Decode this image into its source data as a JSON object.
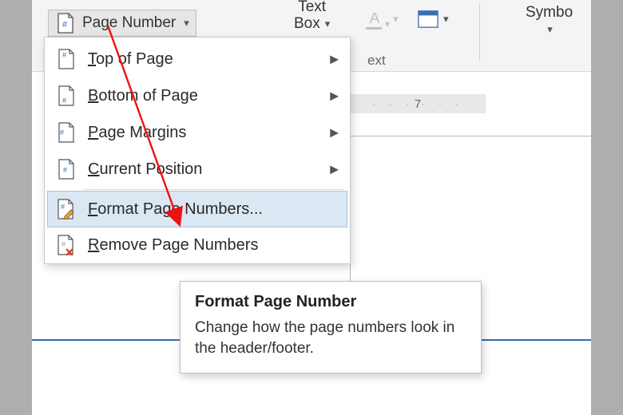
{
  "ribbon": {
    "page_number_label": "Page Number",
    "text_box_line1": "Text",
    "text_box_line2": "Box",
    "font_color_label": "A",
    "symbol_label": "Symbo",
    "group_label_text": "ext"
  },
  "ruler": {
    "tick_label": "7"
  },
  "menu": {
    "items": [
      {
        "label_pre": "",
        "mnemonic": "T",
        "label_post": "op of Page",
        "has_submenu": true
      },
      {
        "label_pre": "",
        "mnemonic": "B",
        "label_post": "ottom of Page",
        "has_submenu": true
      },
      {
        "label_pre": "",
        "mnemonic": "P",
        "label_post": "age Margins",
        "has_submenu": true
      },
      {
        "label_pre": "",
        "mnemonic": "C",
        "label_post": "urrent Position",
        "has_submenu": true
      }
    ],
    "format_item": {
      "label_pre": "",
      "mnemonic": "F",
      "label_post": "ormat Page Numbers..."
    },
    "remove_item": {
      "label_pre": "",
      "mnemonic": "R",
      "label_post": "emove Page Numbers"
    }
  },
  "tooltip": {
    "title": "Format Page Number",
    "desc": "Change how the page numbers look in the header/footer."
  }
}
